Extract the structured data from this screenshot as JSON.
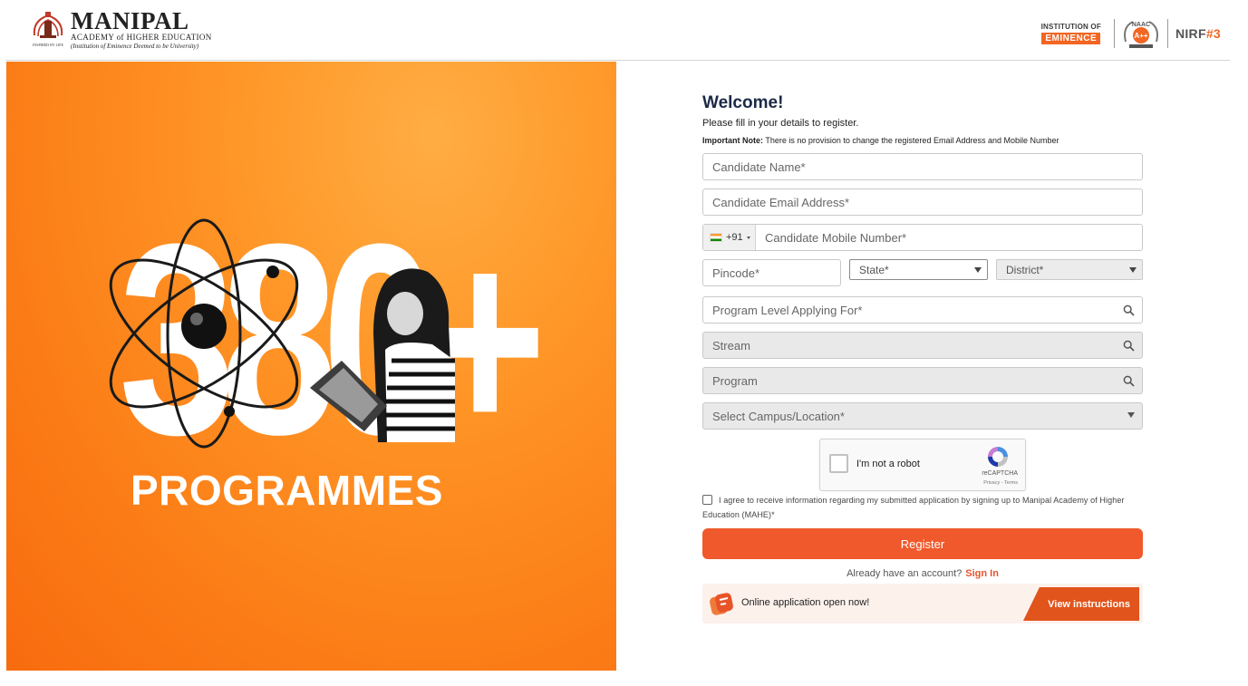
{
  "header": {
    "logo": {
      "name": "MANIPAL",
      "subtitle": "ACADEMY of HIGHER EDUCATION",
      "tagline": "(Institution of Eminence Deemed to be University)"
    },
    "badges": {
      "ioe_top": "INSTITUTION OF",
      "ioe_bottom": "EMINENCE",
      "naac_top": "NAAC",
      "naac_grade": "A++",
      "nirf_label": "NIRF",
      "nirf_rank": "#3"
    }
  },
  "hero": {
    "big_number": "380+",
    "caption": "PROGRAMMES",
    "background_color": "#fb7d17"
  },
  "form": {
    "title": "Welcome!",
    "intro": "Please fill in your details to register.",
    "note_label": "Important Note:",
    "note_text": " There is no provision to change the registered Email Address and Mobile Number",
    "fields": {
      "name_placeholder": "Candidate Name*",
      "email_placeholder": "Candidate Email Address*",
      "phone_code": "+91",
      "phone_placeholder": "Candidate Mobile Number*",
      "pincode_placeholder": "Pincode*",
      "state_placeholder": "State*",
      "district_placeholder": "District*",
      "program_level_placeholder": "Program Level Applying For*",
      "stream_placeholder": "Stream",
      "program_placeholder": "Program",
      "campus_placeholder": "Select Campus/Location*"
    },
    "recaptcha": {
      "label": "I'm not a robot",
      "brand": "reCAPTCHA",
      "terms": "Privacy - Terms"
    },
    "agree_text": "I agree to receive information regarding my submitted application by signing up to Manipal Academy of Higher Education (MAHE)*",
    "register_label": "Register",
    "signin_prompt": "Already have an account?",
    "signin_link": "Sign In",
    "banner_text": "Online application open now!",
    "banner_button": "View instructions",
    "accent_color": "#f0592b"
  }
}
